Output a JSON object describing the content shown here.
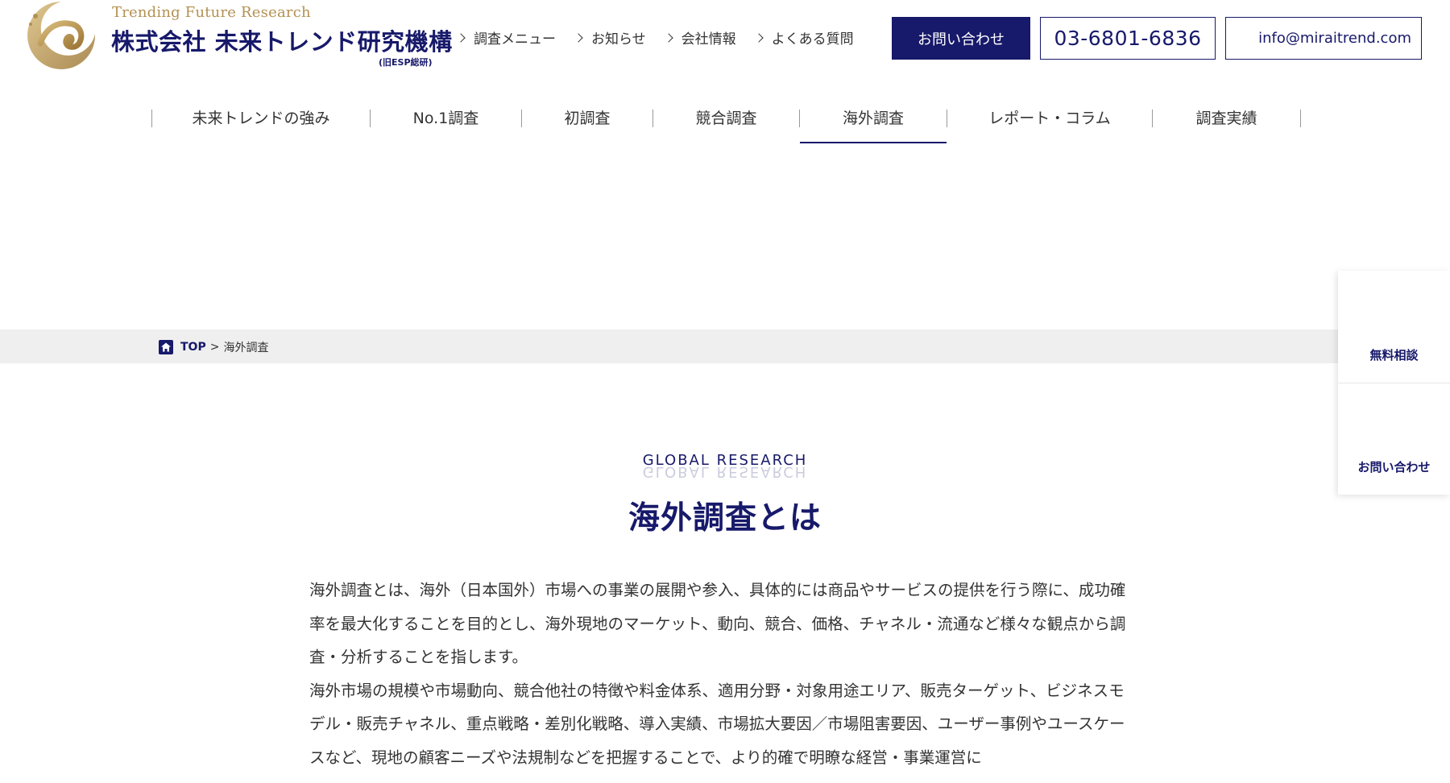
{
  "header": {
    "tagline": "Trending Future Research",
    "company_name": "株式会社 未来トレンド研究機構",
    "company_sub": "(旧ESP総研)",
    "top_links": [
      "調査メニュー",
      "お知らせ",
      "会社情報",
      "よくある質問"
    ],
    "contact_label": "お問い合わせ",
    "phone": "03-6801-6836",
    "email": "info@miraitrend.com"
  },
  "nav": {
    "items": [
      "未来トレンドの強み",
      "No.1調査",
      "初調査",
      "競合調査",
      "海外調査",
      "レポート・コラム",
      "調査実績"
    ],
    "active_index": 4
  },
  "breadcrumb": {
    "home_label": "TOP",
    "separator": ">",
    "current": "海外調査"
  },
  "side_widget": {
    "consult_label": "無料相談",
    "contact_label": "お問い合わせ"
  },
  "section": {
    "en_title": "GLOBAL RESEARCH",
    "title": "海外調査とは",
    "paragraphs": [
      "海外調査とは、海外（日本国外）市場への事業の展開や参入、具体的には商品やサービスの提供を行う際に、成功確率を最大化することを目的とし、海外現地のマーケット、動向、競合、価格、チャネル・流通など様々な観点から調査・分析することを指します。",
      "海外市場の規模や市場動向、競合他社の特徴や料金体系、適用分野・対象用途エリア、販売ターゲット、ビジネスモデル・販売チャネル、重点戦略・差別化戦略、導入実績、市場拡大要因／市場阻害要因、ユーザー事例やユースケースなど、現地の顧客ニーズや法規制などを把握することで、より的確で明瞭な経営・事業運営に"
    ]
  },
  "colors": {
    "brand_navy": "#17196a",
    "logo_gold": "#b39152",
    "breadcrumb_bg": "#efefef"
  },
  "icons": [
    "logo-emblem-icon",
    "chevron-right-icon",
    "home-icon"
  ]
}
